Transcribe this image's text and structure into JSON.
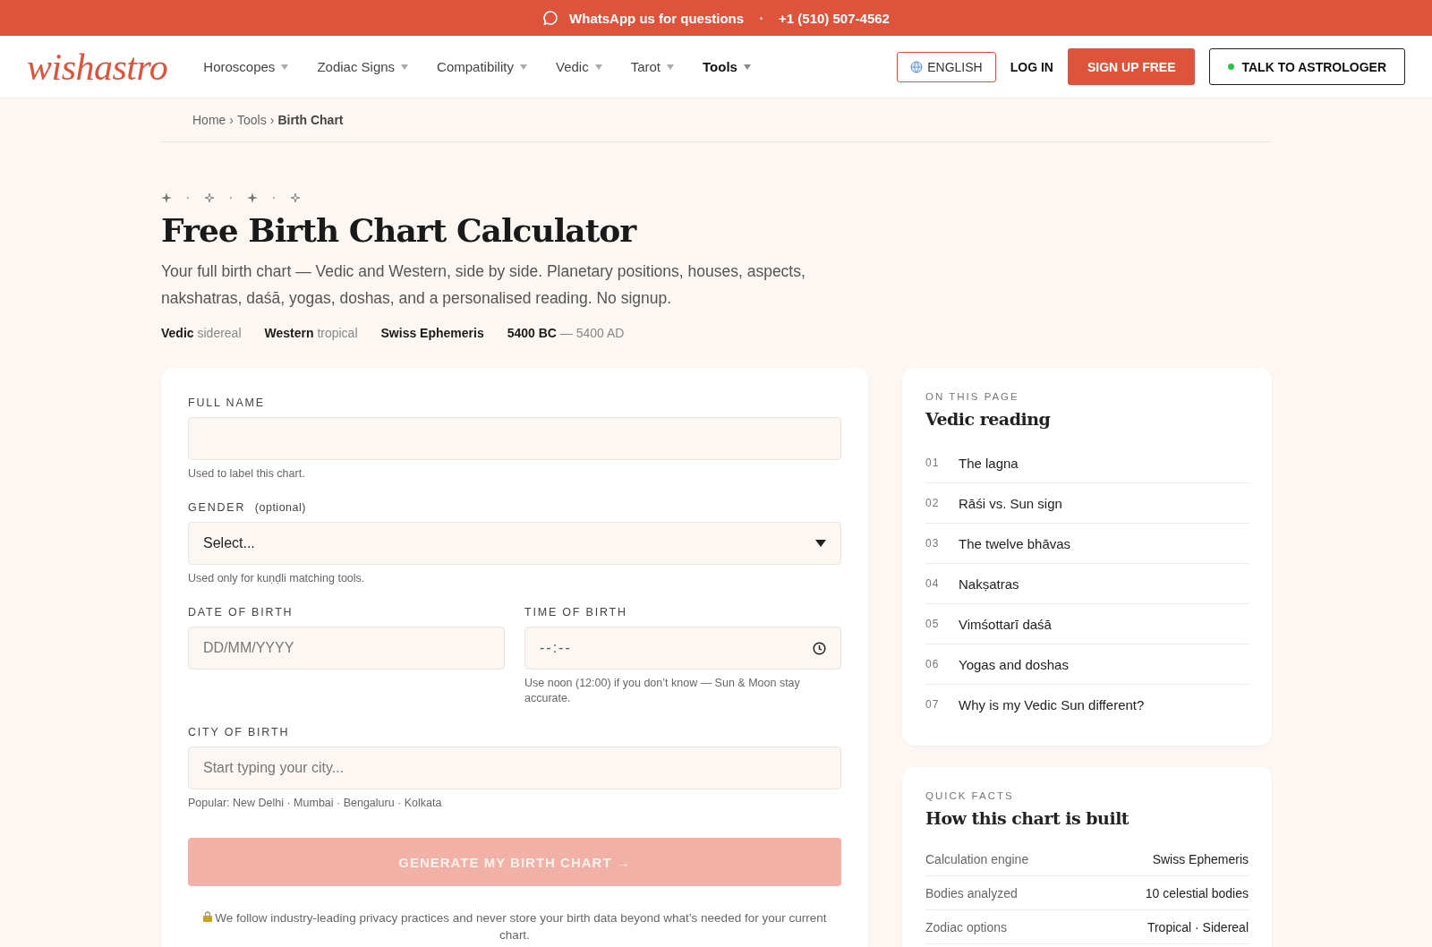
{
  "announcement": {
    "text": "WhatsApp us for questions",
    "phone": "+1 (510) 507-4562"
  },
  "header": {
    "logo": "wishastro",
    "nav": [
      {
        "label": "Horoscopes",
        "selected": false
      },
      {
        "label": "Zodiac Signs",
        "selected": false
      },
      {
        "label": "Compatibility",
        "selected": false
      },
      {
        "label": "Vedic",
        "selected": false
      },
      {
        "label": "Tarot",
        "selected": false
      },
      {
        "label": "Tools",
        "selected": true
      }
    ],
    "language": "ENGLISH",
    "login": "LOG IN",
    "signup": "SIGN UP FREE",
    "talk": "TALK TO ASTROLOGER"
  },
  "breadcrumb": [
    {
      "label": "Home",
      "current": false
    },
    {
      "sep": "›",
      "label": "Tools",
      "current": false
    },
    {
      "sep": "›",
      "label": "Birth Chart",
      "current": true
    }
  ],
  "hero": {
    "title": "Free Birth Chart Calculator",
    "subtitle": "Your full birth chart — Vedic and Western, side by side. Planetary positions, houses, aspects, nakshatras, daśā, yogas, doshas, and a personalised reading. No signup.",
    "meta": [
      "**Vedic** sidereal",
      "**Western** tropical",
      "**Swiss Ephemeris**",
      "**5400 BC** — 5400 AD"
    ]
  },
  "form": {
    "fields": [
      {
        "kind": "text",
        "label": "FULL NAME",
        "hint": "Used to label this chart."
      },
      {
        "kind": "select",
        "label": "GENDER",
        "optional": "(optional)",
        "value": "Select...",
        "hint": "Used only for kuṇḍli matching tools."
      },
      {
        "kind": "date",
        "label": "DATE OF BIRTH",
        "placeholder": "DD/MM/YYYY"
      },
      {
        "kind": "time",
        "label": "TIME OF BIRTH",
        "placeholder": "--:--",
        "hint": "Use noon (12:00) if you don’t know — Sun & Moon stay accurate."
      },
      {
        "kind": "text",
        "label": "CITY OF BIRTH",
        "placeholder": "Start typing your city...",
        "hint": "Popular: New Delhi · Mumbai · Bengaluru · Kolkata"
      }
    ],
    "submit": {
      "label": "GENERATE MY BIRTH CHART →",
      "disabled": true
    },
    "privacy": "We follow industry-leading privacy practices and never store your birth data beyond what’s needed for your current chart."
  },
  "toc": {
    "eyebrow": "ON THIS PAGE",
    "title": "Vedic reading",
    "items": [
      {
        "num": "01",
        "label": "The lagna"
      },
      {
        "num": "02",
        "label": "Rāśi vs. Sun sign"
      },
      {
        "num": "03",
        "label": "The twelve bhāvas"
      },
      {
        "num": "04",
        "label": "Nakṣatras"
      },
      {
        "num": "05",
        "label": "Vimśottarī daśā"
      },
      {
        "num": "06",
        "label": "Yogas and doshas"
      },
      {
        "num": "07",
        "label": "Why is my Vedic Sun different?"
      }
    ]
  },
  "facts": {
    "eyebrow": "QUICK FACTS",
    "title": "How this chart is built",
    "rows": [
      {
        "label": "Calculation engine",
        "value": "Swiss Ephemeris"
      },
      {
        "label": "Bodies analyzed",
        "value": "10 celestial bodies"
      },
      {
        "label": "Zodiac options",
        "value": "Tropical · Sidereal"
      }
    ]
  }
}
